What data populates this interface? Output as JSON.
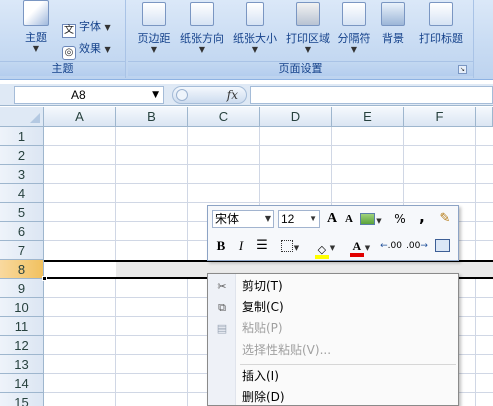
{
  "ribbon": {
    "theme_group": {
      "label": "主题",
      "themes_button": "主题",
      "fonts_button": "字体",
      "effects_button": "效果"
    },
    "page_setup_group": {
      "label": "页面设置",
      "margins": "页边距",
      "orientation": "纸张方向",
      "size": "纸张大小",
      "print_area": "打印区域",
      "breaks": "分隔符",
      "background": "背景",
      "print_titles": "打印标题"
    }
  },
  "formula_bar": {
    "name_box": "A8",
    "fx": "fx",
    "formula": ""
  },
  "grid": {
    "columns": [
      "A",
      "B",
      "C",
      "D",
      "E",
      "F"
    ],
    "rows": [
      "1",
      "2",
      "3",
      "4",
      "5",
      "6",
      "7",
      "8",
      "9",
      "10",
      "11",
      "12",
      "13",
      "14",
      "15"
    ],
    "selected_row": "8"
  },
  "mini_toolbar": {
    "font": "宋体",
    "size": "12",
    "grow_font": "A",
    "shrink_font": "A",
    "percent": "%",
    "comma": ",",
    "bold": "B",
    "italic": "I",
    "font_color": "A",
    "inc_decimal": ".00",
    "dec_decimal": ".00"
  },
  "context_menu": {
    "items": [
      {
        "label": "剪切(T)",
        "icon": "scissors-icon",
        "disabled": false
      },
      {
        "label": "复制(C)",
        "icon": "copy-icon",
        "disabled": false
      },
      {
        "label": "粘贴(P)",
        "icon": "paste-icon",
        "disabled": true
      },
      {
        "label": "选择性粘贴(V)...",
        "icon": "",
        "disabled": true
      },
      {
        "label": "插入(I)",
        "icon": "",
        "disabled": false
      },
      {
        "label": "删除(D)",
        "icon": "",
        "disabled": false
      }
    ]
  }
}
